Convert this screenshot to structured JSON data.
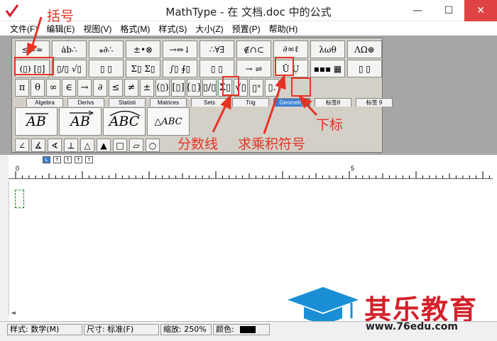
{
  "window": {
    "title": "MathType - 在 文档.doc 中的公式",
    "controls": [
      "—",
      "☐",
      "✕"
    ]
  },
  "menu": [
    "文件(F)",
    "编辑(E)",
    "视图(V)",
    "格式(M)",
    "样式(S)",
    "大小(Z)",
    "预置(P)",
    "帮助(H)"
  ],
  "toolbar": {
    "row1": [
      "≤≠≈",
      "ȧb∴",
      "⁎∂∴",
      "±•⊗",
      "→⇔↓",
      "∴∀∃",
      "∉∩⊂",
      "∂∞ℓ",
      "λωθ",
      "ΛΩ⊛"
    ],
    "row2": [
      "(▯) [▯]",
      "▯/▯ √▯",
      "▯ ▯",
      "Σ▯ Σ▯",
      "∫▯ ∮▯",
      "▯ ▯",
      "→ ⇌",
      "Ū Ụ",
      "▪▪▪ ▦",
      "▯ ▯"
    ],
    "row3": [
      "π",
      "θ",
      "∞",
      "∈",
      "→",
      "∂",
      "≤",
      "≠",
      "±",
      "(▯)",
      "[▯]",
      "{▯}",
      "▯/▯",
      "Σ▯",
      "√▯",
      "▯˟",
      "▯."
    ],
    "tabs": [
      "Algebra",
      "Derivs",
      "Statisti",
      "Matrices",
      "Sets",
      "Trig",
      "Geometry",
      "标签8",
      "标签 9"
    ],
    "templates": [
      "AB",
      "AB",
      "ABC",
      "△ABC"
    ],
    "row5": [
      "∠",
      "∡",
      "∢",
      "⊥",
      "△",
      "▲",
      "□",
      "▱",
      "○"
    ]
  },
  "annotations": {
    "brackets": "括号",
    "fraction": "分数线",
    "product": "求乘积符号",
    "subscript": "下标"
  },
  "ruler": {
    "start": "0",
    "mid": "5"
  },
  "status": {
    "style": "样式: 数学(M)",
    "size": "尺寸: 标准(F)",
    "zoom": "缩放: 250%",
    "color": "颜色:"
  },
  "watermark": {
    "text": "其乐教育",
    "url": "www.76edu.com"
  },
  "colors": {
    "accent_red": "#e53324",
    "tab_active": "#3b7fd0",
    "watermark_red": "#d4202a",
    "watermark_blue": "#1a8fd6"
  }
}
